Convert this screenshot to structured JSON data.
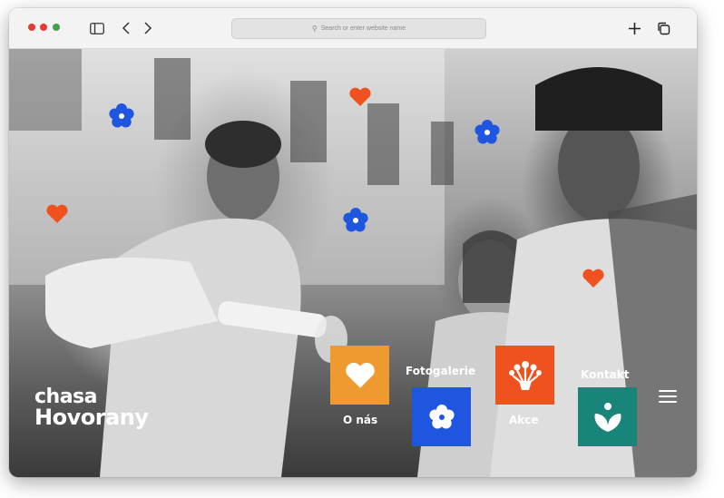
{
  "browser": {
    "address_placeholder": "Search or enter website name"
  },
  "site": {
    "logo_line1": "chasa",
    "logo_line2": "Hovorany"
  },
  "nav": {
    "items": [
      {
        "label": "O nás",
        "color": "#ef9a2e",
        "icon": "heart-icon"
      },
      {
        "label": "Fotogalerie",
        "color": "#1f56e0",
        "icon": "flower-icon"
      },
      {
        "label": "Akce",
        "color": "#f0521f",
        "icon": "bouquet-icon"
      },
      {
        "label": "Kontakt",
        "color": "#18847a",
        "icon": "sprout-icon"
      }
    ]
  },
  "colors": {
    "blue": "#1f56e0",
    "orange": "#f0521f",
    "amber": "#ef9a2e",
    "teal": "#18847a"
  }
}
